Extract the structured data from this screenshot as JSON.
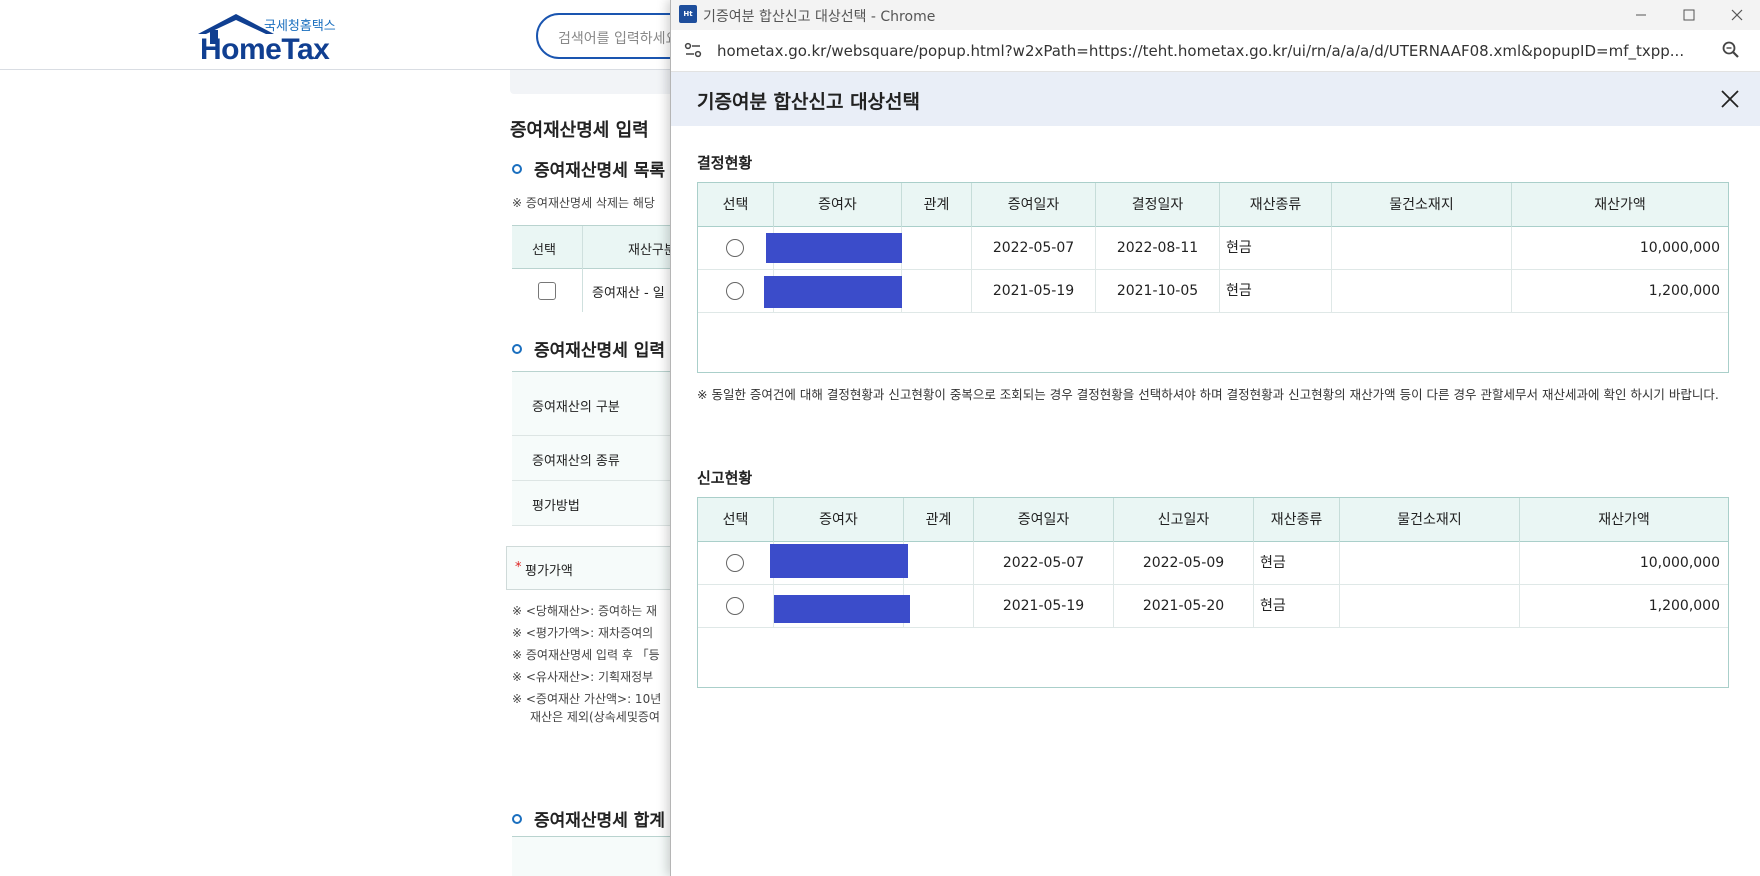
{
  "background": {
    "logo": {
      "sub": "국세청홈택스",
      "main": "HomeTax"
    },
    "search_placeholder": "검색어를 입력하세요",
    "section_title": "증여재산명세 입력",
    "list_title": "증여재산명세 목록",
    "list_note": "※ 증여재산명세 삭제는 해당",
    "list_table": {
      "col_select": "선택",
      "col_type": "재산구분",
      "row_text": "증여재산 - 일"
    },
    "input_title": "증여재산명세 입력",
    "form_rows": [
      "증여재산의 구분",
      "증여재산의 종류",
      "평가방법"
    ],
    "eval_label": "평가가액",
    "eval_required_mark": "*",
    "notes": [
      "※ <당해재산>: 증여하는 재",
      "※ <평가가액>: 재차증여의",
      "※ 증여재산명세 입력 후 「등",
      "※ <유사재산>: 기획재정부",
      "※ <증여재산 가산액>: 10년",
      "재산은 제외(상속세및증여"
    ],
    "total_title": "증여재산명세 합계"
  },
  "window": {
    "title": "기증여분 합산신고 대상선택 - Chrome",
    "url": "hometax.go.kr/websquare/popup.html?w2xPath=https://teht.hometax.go.kr/ui/rn/a/a/a/d/UTERNAAF08.xml&popupID=mf_txpp..."
  },
  "popup": {
    "title": "기증여분 합산신고 대상선택",
    "decision": {
      "title": "결정현황",
      "columns": [
        "선택",
        "증여자",
        "관계",
        "증여일자",
        "결정일자",
        "재산종류",
        "물건소재지",
        "재산가액"
      ],
      "rows": [
        {
          "gift_date": "2022-05-07",
          "decision_date": "2022-08-11",
          "asset_type": "현금",
          "location": "",
          "amount": "10,000,000"
        },
        {
          "gift_date": "2021-05-19",
          "decision_date": "2021-10-05",
          "asset_type": "현금",
          "location": "",
          "amount": "1,200,000"
        }
      ]
    },
    "notice": "※ 동일한 증여건에 대해 결정현황과 신고현황이 중복으로 조회되는 경우 결정현황을 선택하셔야 하며 결정현황과 신고현황의 재산가액 등이 다른 경우 관할세무서 재산세과에 확인 하시기 바랍니다.",
    "report": {
      "title": "신고현황",
      "columns": [
        "선택",
        "증여자",
        "관계",
        "증여일자",
        "신고일자",
        "재산종류",
        "물건소재지",
        "재산가액"
      ],
      "rows": [
        {
          "gift_date": "2022-05-07",
          "report_date": "2022-05-09",
          "asset_type": "현금",
          "location": "",
          "amount": "10,000,000"
        },
        {
          "gift_date": "2021-05-19",
          "report_date": "2021-05-20",
          "asset_type": "현금",
          "location": "",
          "amount": "1,200,000"
        }
      ]
    }
  },
  "colors": {
    "accent": "#1a55b0",
    "grid_head": "#eaf6f4",
    "redaction": "#3b4cca",
    "popup_header": "#e9eef7"
  }
}
